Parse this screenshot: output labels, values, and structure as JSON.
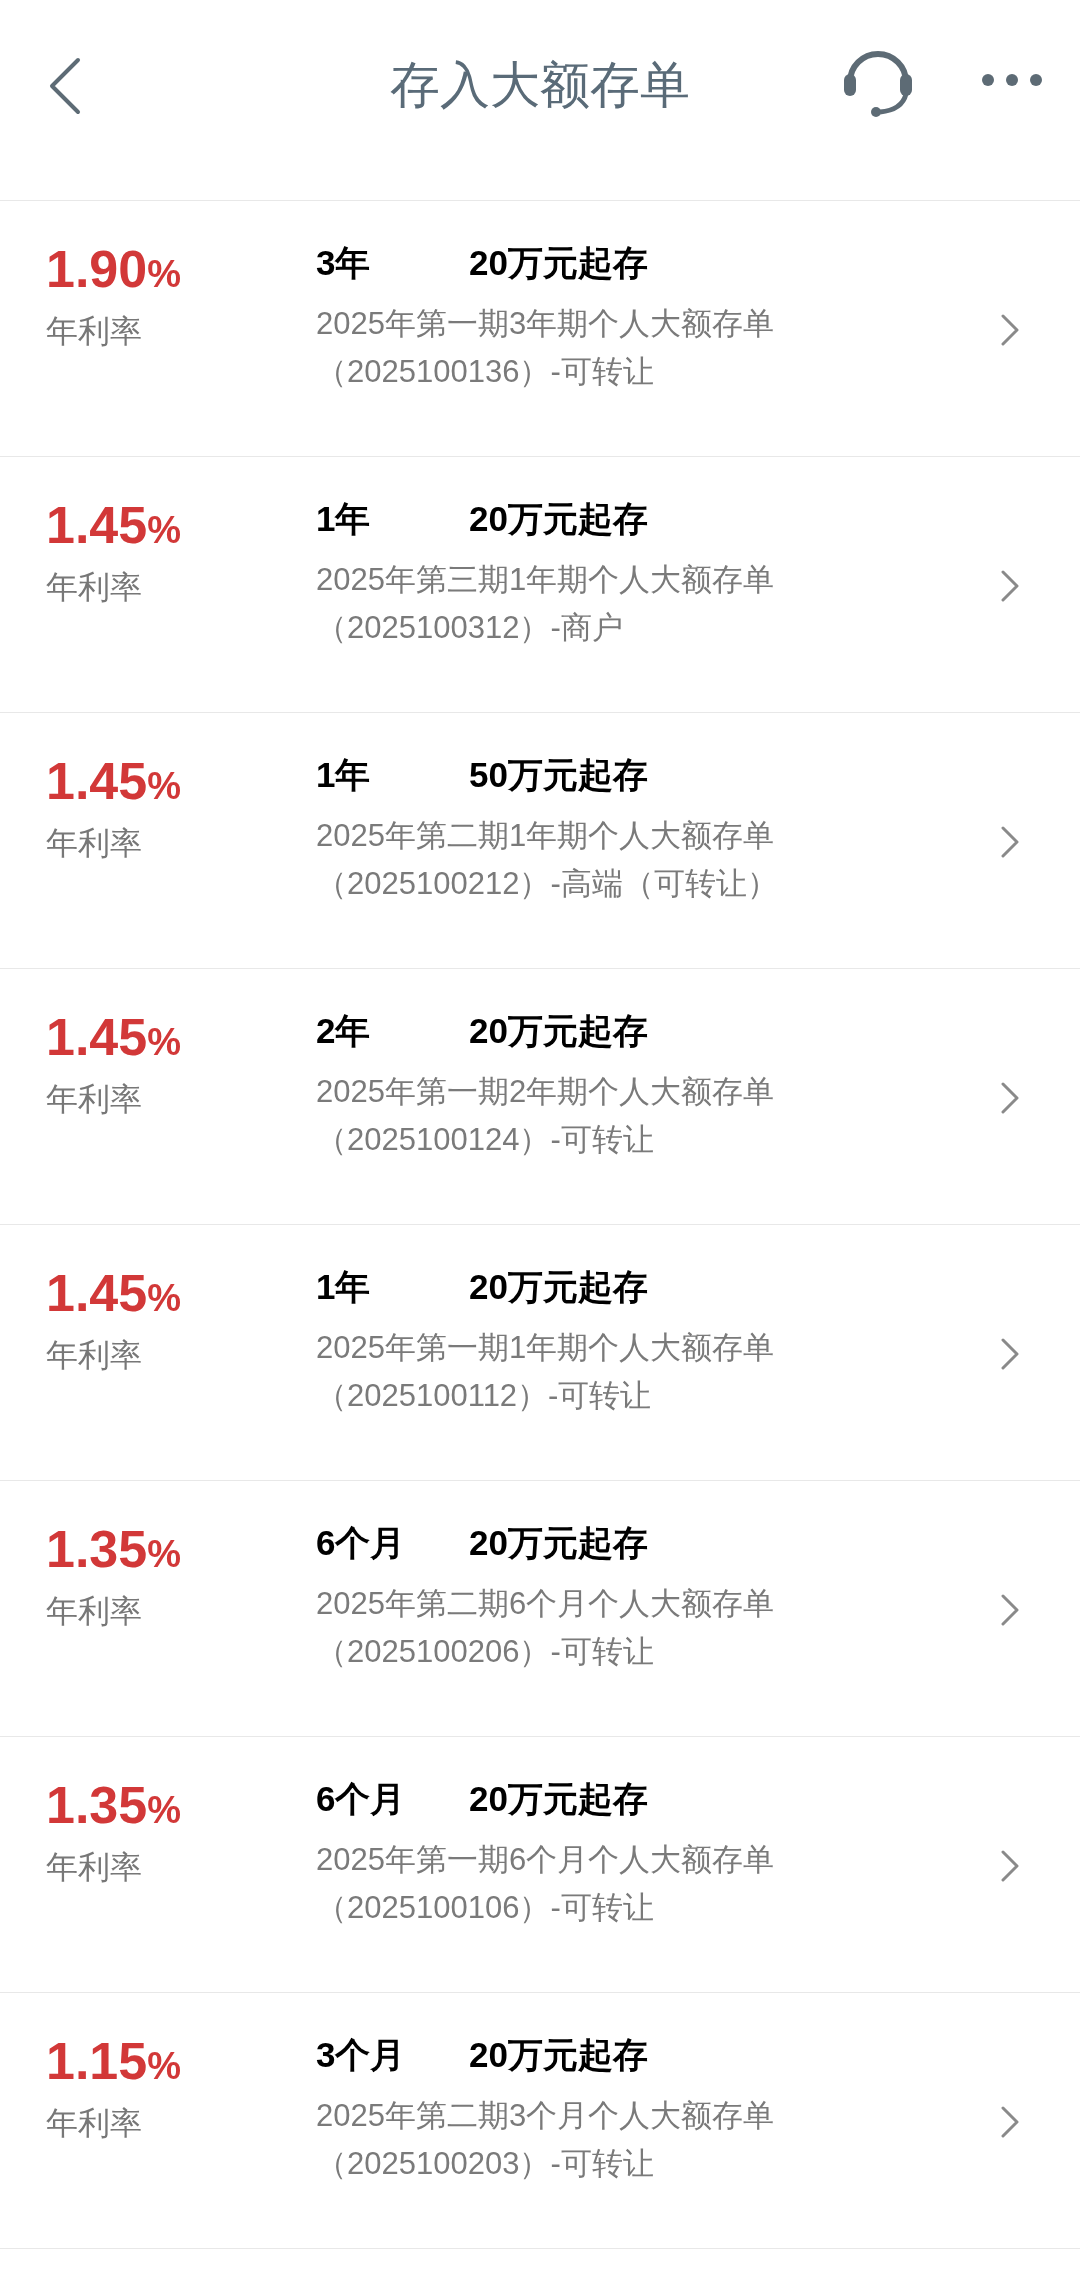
{
  "header": {
    "title": "存入大额存单"
  },
  "products": [
    {
      "rate": "1.90",
      "rate_unit": "%",
      "rate_label": "年利率",
      "term": "3年",
      "minimum": "20万元起存",
      "description": "2025年第一期3年期个人大额存单（2025100136）-可转让"
    },
    {
      "rate": "1.45",
      "rate_unit": "%",
      "rate_label": "年利率",
      "term": "1年",
      "minimum": "20万元起存",
      "description": "2025年第三期1年期个人大额存单（2025100312）-商户"
    },
    {
      "rate": "1.45",
      "rate_unit": "%",
      "rate_label": "年利率",
      "term": "1年",
      "minimum": "50万元起存",
      "description": "2025年第二期1年期个人大额存单（2025100212）-高端（可转让）"
    },
    {
      "rate": "1.45",
      "rate_unit": "%",
      "rate_label": "年利率",
      "term": "2年",
      "minimum": "20万元起存",
      "description": "2025年第一期2年期个人大额存单（2025100124）-可转让"
    },
    {
      "rate": "1.45",
      "rate_unit": "%",
      "rate_label": "年利率",
      "term": "1年",
      "minimum": "20万元起存",
      "description": "2025年第一期1年期个人大额存单（2025100112）-可转让"
    },
    {
      "rate": "1.35",
      "rate_unit": "%",
      "rate_label": "年利率",
      "term": "6个月",
      "minimum": "20万元起存",
      "description": "2025年第二期6个月个人大额存单（2025100206）-可转让"
    },
    {
      "rate": "1.35",
      "rate_unit": "%",
      "rate_label": "年利率",
      "term": "6个月",
      "minimum": "20万元起存",
      "description": "2025年第一期6个月个人大额存单（2025100106）-可转让"
    },
    {
      "rate": "1.15",
      "rate_unit": "%",
      "rate_label": "年利率",
      "term": "3个月",
      "minimum": "20万元起存",
      "description": "2025年第二期3个月个人大额存单（2025100203）-可转让"
    }
  ]
}
